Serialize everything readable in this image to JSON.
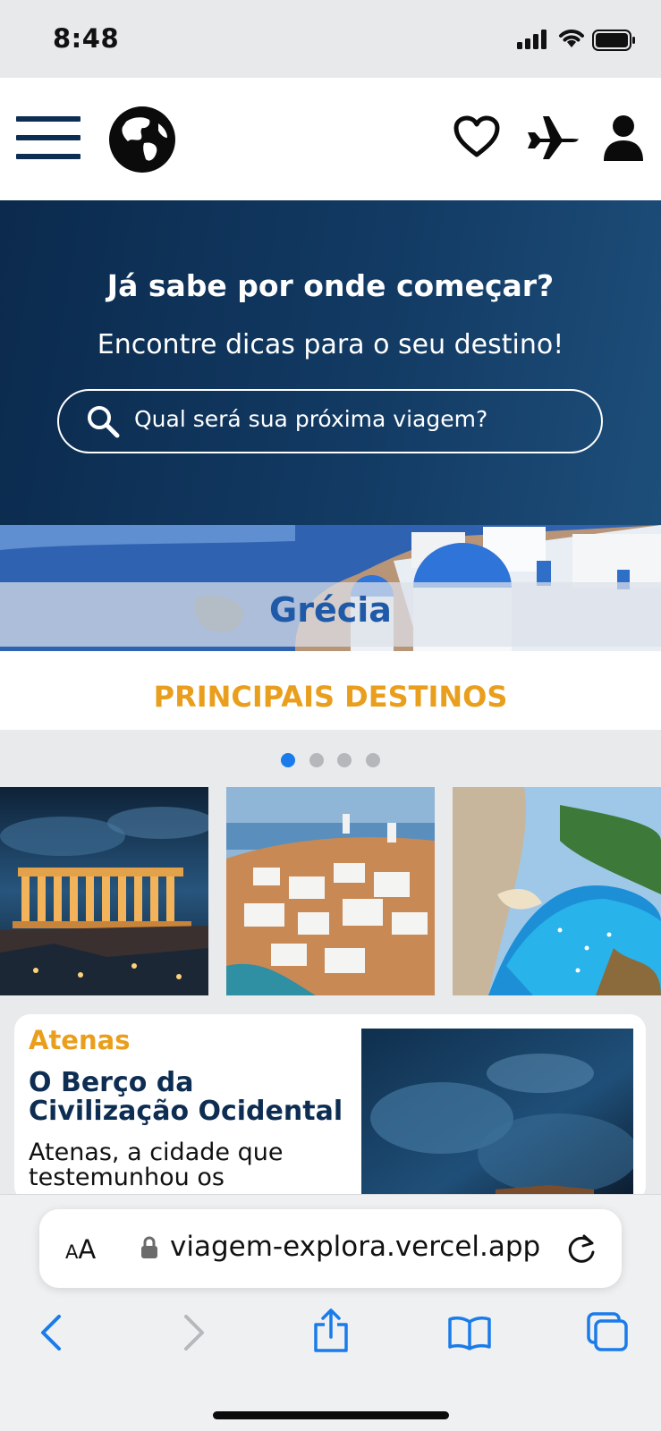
{
  "status_bar": {
    "time": "8:48"
  },
  "header": {
    "icons": [
      "menu-icon",
      "globe-icon",
      "heart-icon",
      "plane-icon",
      "user-icon"
    ],
    "brand_color": "#0d2d52"
  },
  "hero": {
    "title": "Já sabe por onde começar?",
    "subtitle": "Encontre dicas para o seu destino!",
    "search_placeholder": "Qual será sua próxima viagem?",
    "background_color": "#0b2a4d"
  },
  "banner": {
    "label": "Grécia",
    "label_color": "#1f5aa8"
  },
  "destinations": {
    "heading": "PRINCIPAIS DESTINOS",
    "heading_color": "#e99f1d",
    "carousel_pages": 4,
    "active_page": 1,
    "thumbnails": [
      "acropolis-night-photo",
      "santorini-village-photo",
      "navagio-beach-photo"
    ]
  },
  "card": {
    "city": "Atenas",
    "title": "O Berço da Civilização Ocidental",
    "text": "Atenas, a cidade que testemunhou os"
  },
  "browser": {
    "text_size_label": "AA",
    "url": "viagem-explora.vercel.app",
    "toolbar_icons": [
      "back-icon",
      "forward-icon",
      "share-icon",
      "bookmarks-icon",
      "tabs-icon"
    ],
    "accent_color": "#1a7bea"
  }
}
